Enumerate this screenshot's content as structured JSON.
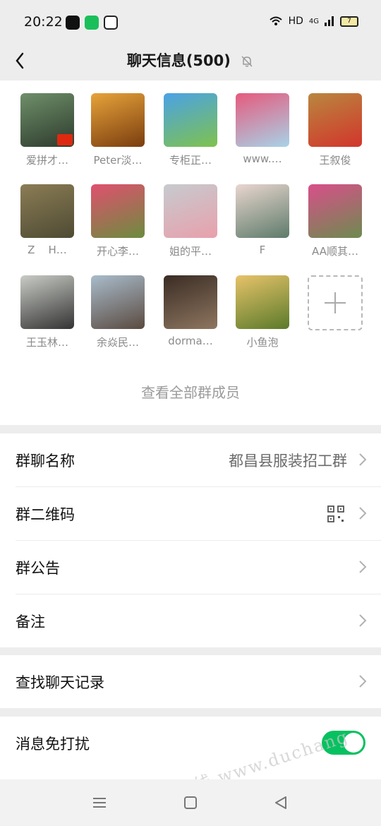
{
  "status_bar": {
    "time": "20:22",
    "network": "HD",
    "signal": "4G",
    "battery": "7"
  },
  "header": {
    "title": "聊天信息(500)",
    "back_icon": "chevron-left-icon",
    "mute_icon": "bell-off-icon"
  },
  "members": [
    {
      "name": "爱拼才…",
      "colors": [
        "#6f8f6a",
        "#2d3b2c"
      ]
    },
    {
      "name": "Peter淡…",
      "colors": [
        "#e7a33a",
        "#7a3d0f"
      ]
    },
    {
      "name": "专柜正…",
      "colors": [
        "#4aa2e6",
        "#7fc24d"
      ]
    },
    {
      "name": "www.…",
      "colors": [
        "#e65a7d",
        "#a7d3e8"
      ]
    },
    {
      "name": "王叙俊",
      "colors": [
        "#b9873f",
        "#d2352b"
      ]
    },
    {
      "name": "Z    H…",
      "colors": [
        "#8b7d55",
        "#4e4a33"
      ]
    },
    {
      "name": "开心李…",
      "colors": [
        "#e0506f",
        "#6c8c3e"
      ]
    },
    {
      "name": "姐的平…",
      "colors": [
        "#c6cbcf",
        "#e8a0ac"
      ]
    },
    {
      "name": "F",
      "colors": [
        "#e9d6cf",
        "#5d7b6a"
      ]
    },
    {
      "name": "AA顺其…",
      "colors": [
        "#d94f8a",
        "#6d8b4f"
      ]
    },
    {
      "name": "王玉林…",
      "colors": [
        "#c9ccc6",
        "#333333"
      ]
    },
    {
      "name": "余焱民…",
      "colors": [
        "#a9bccb",
        "#5a4a40"
      ]
    },
    {
      "name": "dorma…",
      "colors": [
        "#3a2c24",
        "#8e7660"
      ]
    },
    {
      "name": "小鱼泡",
      "colors": [
        "#e7c36a",
        "#5a7a2a"
      ]
    }
  ],
  "add_member_icon": "plus-icon",
  "view_all_label": "查看全部群成员",
  "settings": {
    "group_name_label": "群聊名称",
    "group_name_value": "都昌县服装招工群",
    "qr_label": "群二维码",
    "qr_icon": "qr-code-icon",
    "notice_label": "群公告",
    "remark_label": "备注",
    "search_label": "查找聊天记录",
    "mute_label": "消息免打扰",
    "mute_on": true
  },
  "colors": {
    "accent": "#07c160",
    "background": "#ededed"
  },
  "watermark": "都昌在线 www.duchang"
}
